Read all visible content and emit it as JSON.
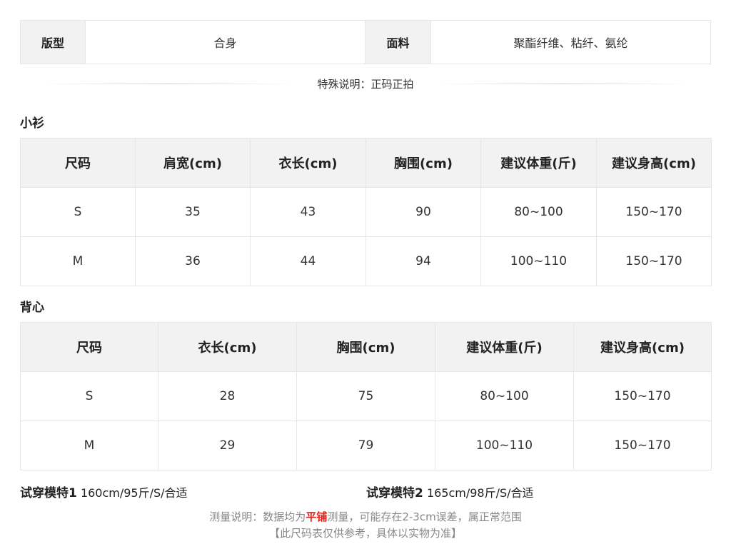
{
  "info": {
    "fit_label": "版型",
    "fit_value": "合身",
    "fabric_label": "面料",
    "fabric_value": "聚酯纤维、粘纤、氨纶"
  },
  "special_note": "特殊说明：正码正拍",
  "top_section": {
    "title": "小衫",
    "headers": [
      "尺码",
      "肩宽(cm)",
      "衣长(cm)",
      "胸围(cm)",
      "建议体重(斤)",
      "建议身高(cm)"
    ],
    "rows": [
      [
        "S",
        "35",
        "43",
        "90",
        "80~100",
        "150~170"
      ],
      [
        "M",
        "36",
        "44",
        "94",
        "100~110",
        "150~170"
      ]
    ]
  },
  "vest_section": {
    "title": "背心",
    "headers": [
      "尺码",
      "衣长(cm)",
      "胸围(cm)",
      "建议体重(斤)",
      "建议身高(cm)"
    ],
    "rows": [
      [
        "S",
        "28",
        "75",
        "80~100",
        "150~170"
      ],
      [
        "M",
        "29",
        "79",
        "100~110",
        "150~170"
      ]
    ]
  },
  "models": [
    {
      "label": "试穿模特1",
      "value": "160cm/95斤/S/合适"
    },
    {
      "label": "试穿模特2",
      "value": "165cm/98斤/S/合适"
    }
  ],
  "measure_note": {
    "prefix": "测量说明：数据均为",
    "highlight": "平铺",
    "suffix": "测量，可能存在2-3cm误差，属正常范围",
    "highlight_color": "#e0241a"
  },
  "reference_note": "【此尺码表仅供参考，具体以实物为准】"
}
